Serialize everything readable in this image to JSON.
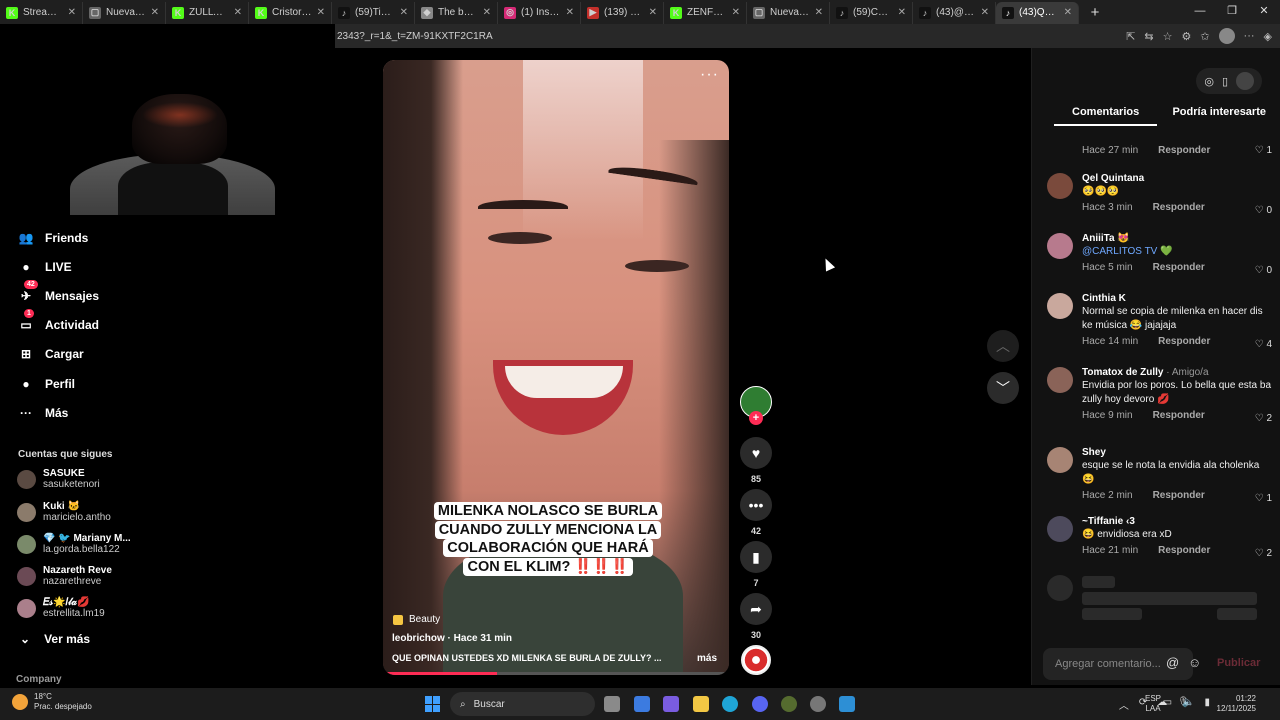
{
  "browser": {
    "tabs": [
      {
        "title": "Stream - Kick",
        "color": "#53fc18",
        "glyph": "K"
      },
      {
        "title": "Nueva pestaña",
        "color": "#666666",
        "glyph": "▢"
      },
      {
        "title": "ZULLYY_CS",
        "color": "#53fc18",
        "glyph": "K"
      },
      {
        "title": "Cristorata7",
        "color": "#53fc18",
        "glyph": "K"
      },
      {
        "title": "(59)TikTok -",
        "color": "#111111",
        "glyph": "♪"
      },
      {
        "title": "The best Ch",
        "color": "#888888",
        "glyph": "◆"
      },
      {
        "title": "(1) Instagram",
        "color": "#d62976",
        "glyph": "◎"
      },
      {
        "title": "(139) Fuerza",
        "color": "#c4302b",
        "glyph": "▶"
      },
      {
        "title": "ZENFLUENC",
        "color": "#53fc18",
        "glyph": "K"
      },
      {
        "title": "Nueva pesta",
        "color": "#666666",
        "glyph": "▢"
      },
      {
        "title": "(59)Cuando",
        "color": "#111111",
        "glyph": "♪"
      },
      {
        "title": "(43)@Zully",
        "color": "#111111",
        "glyph": "♪"
      },
      {
        "title": "(43)QUE OP",
        "color": "#111111",
        "glyph": "♪",
        "active": true
      }
    ],
    "url": "2343?_r=1&_t=ZM-91KXTF2C1RA"
  },
  "sidebar": {
    "nav": [
      {
        "label": "Friends",
        "icon": "friends-icon",
        "glyph": "👥"
      },
      {
        "label": "LIVE",
        "icon": "live-icon",
        "glyph": "●"
      },
      {
        "label": "Mensajes",
        "icon": "messages-icon",
        "glyph": "✈",
        "badge": "42"
      },
      {
        "label": "Actividad",
        "icon": "activity-icon",
        "glyph": "▭",
        "badge": "1"
      },
      {
        "label": "Cargar",
        "icon": "upload-icon",
        "glyph": "⊞"
      },
      {
        "label": "Perfil",
        "icon": "profile-icon",
        "glyph": "●"
      },
      {
        "label": "Más",
        "icon": "more-icon",
        "glyph": "···"
      }
    ],
    "following_title": "Cuentas que sigues",
    "following": [
      {
        "name": "SASUKE",
        "user": "sasuketenori"
      },
      {
        "name": "Kuki 🐱",
        "user": "maricielo.antho"
      },
      {
        "name": "💎 🐦 Mariany M...",
        "user": "la.gorda.bella122"
      },
      {
        "name": "Nazareth Rеve",
        "user": "nazarethreve"
      },
      {
        "name": "𝐸𝓈🌟𝐼𝓁𝒶💋",
        "user": "estrellita.lm19"
      }
    ],
    "see_more": "Ver más",
    "company": "Company"
  },
  "video": {
    "caption_text": "MILENKA NOLASCO SE BURLA CUANDO ZULLY MENCIONA LA COLABORACIÓN QUE HARÁ CON EL KLIM?",
    "caption_marks": "‼️‼️‼️",
    "tag": "Beauty",
    "author_line": "leobrichow · Hace 31 min",
    "description": "QUE OPINAN USTEDES XD MILENKA SE BURLA DE ZULLY? ...",
    "more": "más",
    "progress": 0.33
  },
  "actions": {
    "likes": "85",
    "comments": "42",
    "saves": "7",
    "shares": "30"
  },
  "panel": {
    "tab_comments": "Comentarios",
    "tab_interest": "Podría interesarte",
    "reply_label": "Responder",
    "first_meta": {
      "time": "Hace 27 min",
      "likes": "1"
    },
    "comments": [
      {
        "name": "Qel Quintana",
        "sub": "",
        "text": "🥺🥺🥺",
        "time": "Hace 3 min",
        "likes": "0",
        "avatar": "#7a4a3c"
      },
      {
        "name": "AniiiTa 😻",
        "sub": "",
        "text": "@CARLITOS TV 💚",
        "time": "Hace 5 min",
        "likes": "0",
        "avatar": "#b77a8d",
        "mention": true
      },
      {
        "name": "Cinthia K",
        "sub": "",
        "text": "Normal se copia de milenka en hacer dis ke música 😂 jajajaja",
        "time": "Hace 14 min",
        "likes": "4",
        "avatar": "#c9a89d"
      },
      {
        "name": "Tomatox de Zully",
        "sub": " · Amigo/a",
        "text": "Envidia por los poros. Lo bella que esta ba zully hoy devoro 💋",
        "time": "Hace 9 min",
        "likes": "2",
        "avatar": "#8a6358"
      },
      {
        "name": "Shey",
        "sub": "",
        "text": "esque se le nota la envidia ala cholenka 😆",
        "time": "Hace 2 min",
        "likes": "1",
        "avatar": "#a78474"
      },
      {
        "name": "~Tiffanie ‹3",
        "sub": "",
        "text": "😆 envidiosa era xD",
        "time": "Hace 21 min",
        "likes": "2",
        "avatar": "#4d4a5c"
      }
    ],
    "comment_placeholder": "Agregar comentario...",
    "publish": "Publicar"
  },
  "taskbar": {
    "temp": "18°C",
    "weather": "Prac. despejado",
    "search": "Buscar",
    "lang1": "ESP",
    "lang2": "LAA",
    "time": "01:22",
    "date": "12/11/2025"
  }
}
